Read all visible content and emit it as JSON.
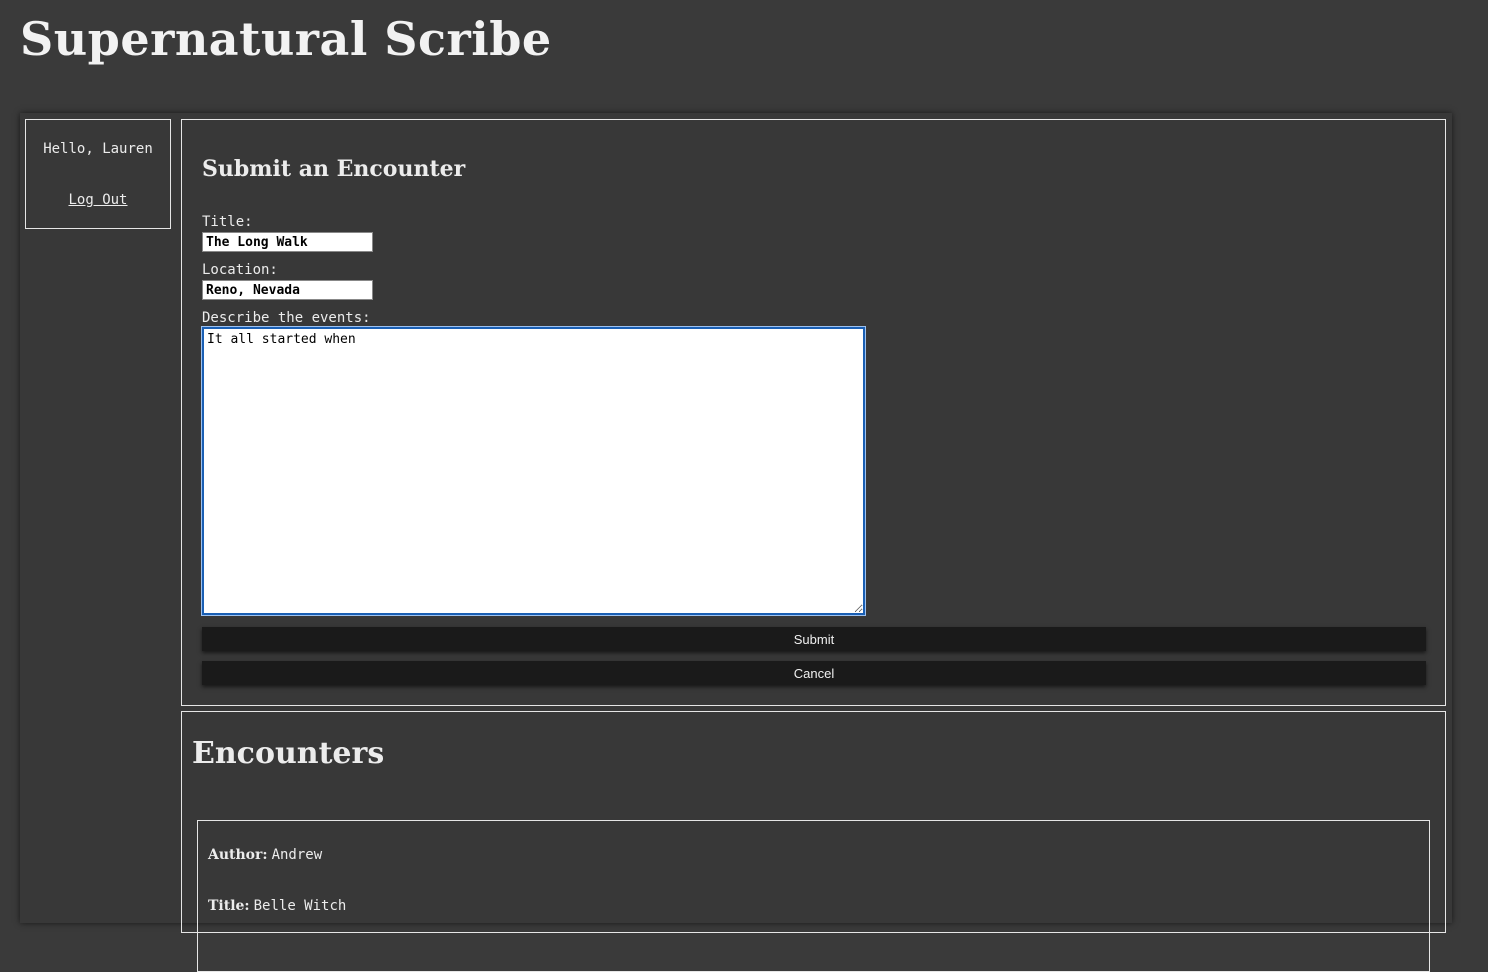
{
  "site": {
    "title": "Supernatural Scribe"
  },
  "user": {
    "greeting": "Hello, Lauren",
    "logout_label": "Log Out"
  },
  "form": {
    "heading": "Submit an Encounter",
    "title_label": "Title:",
    "title_value": "The Long Walk",
    "location_label": "Location:",
    "location_value": "Reno, Nevada",
    "events_label": "Describe the events:",
    "events_value": "It all started when",
    "submit_label": "Submit",
    "cancel_label": "Cancel"
  },
  "encounters": {
    "heading": "Encounters",
    "items": [
      {
        "author_label": "Author:",
        "author": "Andrew",
        "title_label": "Title:",
        "title": "Belle Witch"
      }
    ]
  },
  "colors": {
    "background": "#3a3a3a",
    "button": "#1a1a1a",
    "border": "#e6e6e6",
    "focus": "#1a5fb4"
  }
}
